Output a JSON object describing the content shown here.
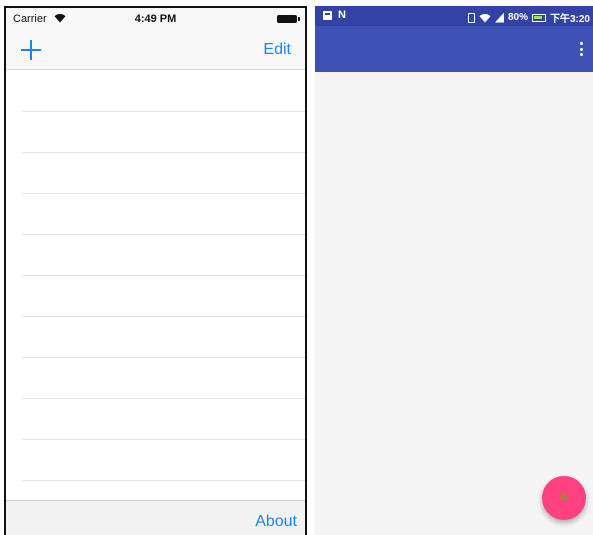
{
  "ios": {
    "status_bar": {
      "carrier": "Carrier",
      "time": "4:49 PM"
    },
    "nav_bar": {
      "edit_label": "Edit",
      "add_icon": "plus-icon"
    },
    "table": {
      "row_count": 10
    },
    "toolbar": {
      "about_label": "About"
    },
    "colors": {
      "tint": "#1a84ff",
      "bar_background": "#f8f8f8"
    }
  },
  "android": {
    "status_bar": {
      "battery": "80%",
      "time": "下午3:20"
    },
    "toolbar": {
      "overflow_icon": "more-vert-icon"
    },
    "fab": {
      "icon": "triangle-icon"
    },
    "colors": {
      "primary": "#3f51b5",
      "primary_dark": "#3343a5",
      "accent": "#ff4081",
      "background": "#f5f5f5"
    }
  }
}
